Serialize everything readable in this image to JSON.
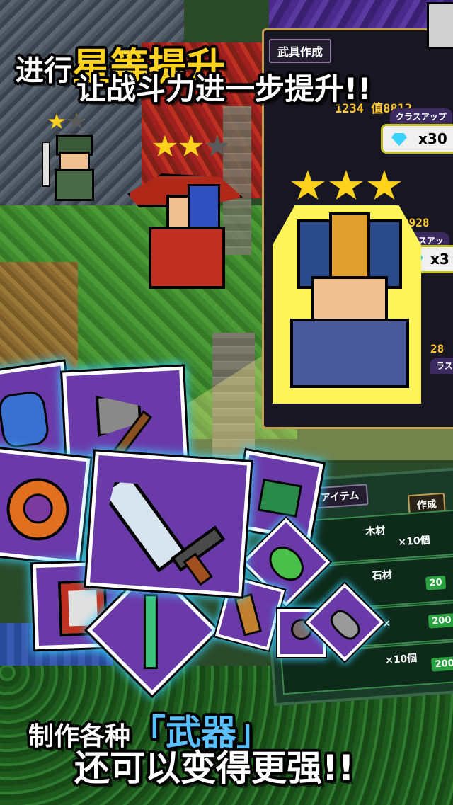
{
  "headline_top": {
    "line1_pre": "进行",
    "line1_highlight": "星等提升",
    "line2": "让战斗力进一步提升!!"
  },
  "headline_bottom": {
    "line1_pre": "制作各种",
    "line1_bracket_open": "「",
    "line1_highlight": "武器",
    "line1_bracket_close": "」",
    "line2": "还可以变得更强!!"
  },
  "weapon_craft_tab": "武具作成",
  "class_panel": {
    "power_top": "1234",
    "power_top_arrow": "值",
    "power_top_new": "8812",
    "class_up_label": "クラスアップ",
    "gem_cost": "x30",
    "power_mid": "2928",
    "class_up_label_2": "ラスアッ",
    "gem_cost_2": "x3",
    "power_low": "28",
    "class_up_label_3": "ラス"
  },
  "item_panel": {
    "tab_items": "アイテム",
    "tab_make": "作成",
    "rows": [
      {
        "name": "木材",
        "qty": "×10個"
      },
      {
        "name": "石材",
        "qty": ""
      },
      {
        "name": "",
        "qty": "×"
      },
      {
        "name": "",
        "qty": "×10個"
      }
    ],
    "cost_badges": [
      "20",
      "20",
      "200",
      "200"
    ],
    "x_marks": [
      "×",
      "×",
      "×",
      "×"
    ]
  },
  "stars": {
    "soldier": 1,
    "mage": 2,
    "knight": 3,
    "max": 3
  },
  "icons": {
    "gem": "diamond-icon",
    "star": "star-icon"
  },
  "colors": {
    "highlight_yellow": "#ffd21e",
    "highlight_blue": "#58c0ff",
    "card_purple": "#6a3aa8",
    "card_glow": "#3ad0ff"
  }
}
